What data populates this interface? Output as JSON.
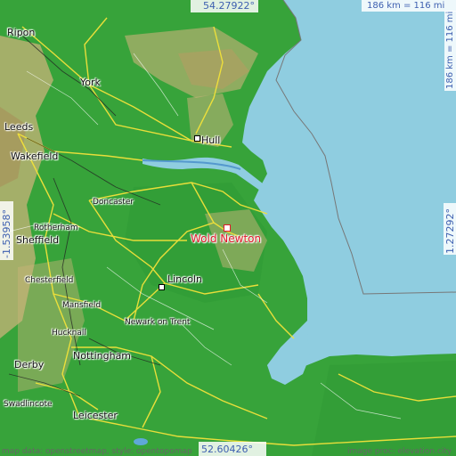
{
  "scale": {
    "top": "186 km = 116 mi",
    "right": "186 km = 116 mi"
  },
  "coords": {
    "top_lat": "54.27922°",
    "bottom_lat": "52.60426°",
    "left_lon": "-1.53958°",
    "right_lon": "1.27292°"
  },
  "target": {
    "name": "Wold Newton"
  },
  "cities": {
    "ripon": "Ripon",
    "york": "York",
    "leeds": "Leeds",
    "hull": "Hull",
    "wakefield": "Wakefield",
    "doncaster": "Doncaster",
    "rotherham": "Rotherham",
    "sheffield": "Sheffield",
    "lincoln": "Lincoln",
    "chesterfield": "Chesterfield",
    "mansfield": "Mansfield",
    "newark": "Newark on Trent",
    "hucknall": "Hucknall",
    "nottingham": "Nottingham",
    "derby": "Derby",
    "swadlincote": "Swadlincote",
    "leicester": "Leicester"
  },
  "attribution": {
    "left": "map data: openstreetmap, style: opentopomap",
    "right": "image proc: elevation.city"
  },
  "colors": {
    "sea": "#8fcde0",
    "lowland": "#37a33a",
    "upland": "#c9b37a",
    "target": "#e0192a",
    "coord_text": "#3d5fb0"
  }
}
